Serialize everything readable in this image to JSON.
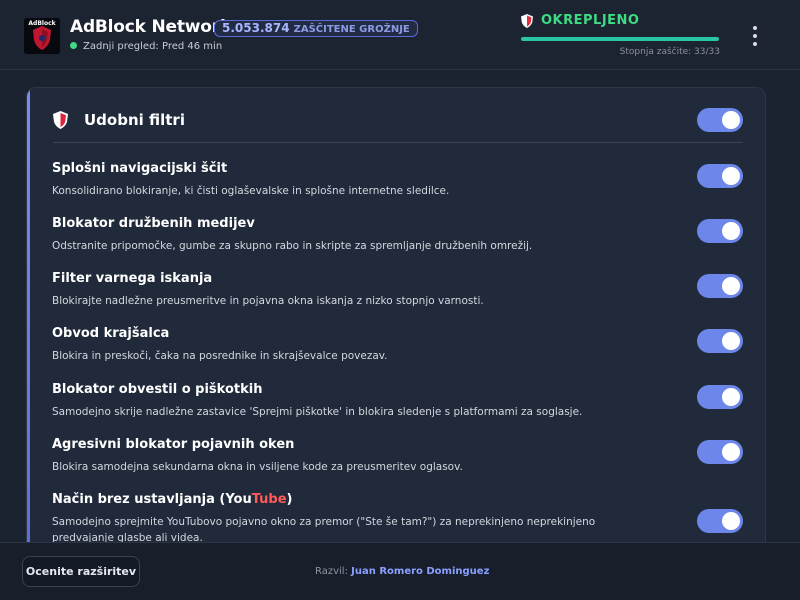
{
  "header": {
    "logo_text": "AdBlock",
    "app_title": "AdBlock Network",
    "threat_count": "5.053.874",
    "threat_label": "ZAŠČITENE GROŽNJE",
    "last_review": "Zadnji pregled: Pred 46 min",
    "status": "OKREPLJENO",
    "protection_progress": 1.0,
    "protection_level": "Stopnja zaščite: 33/33",
    "status_color": "#3ddc84",
    "accent_color": "#6d86ea"
  },
  "card": {
    "title": "Udobni filtri",
    "master_toggle_on": true,
    "filters": [
      {
        "title": "Splošni navigacijski ščit",
        "description": "Konsolidirano blokiranje, ki čisti oglaševalske in splošne internetne sledilce.",
        "enabled": true
      },
      {
        "title": "Blokator družbenih medijev",
        "description": "Odstranite pripomočke, gumbe za skupno rabo in skripte za spremljanje družbenih omrežij.",
        "enabled": true
      },
      {
        "title": "Filter varnega iskanja",
        "description": "Blokirajte nadležne preusmeritve in pojavna okna iskanja z nizko stopnjo varnosti.",
        "enabled": true
      },
      {
        "title": "Obvod krajšalca",
        "description": "Blokira in preskoči, čaka na posrednike in skrajševalce povezav.",
        "enabled": true
      },
      {
        "title": "Blokator obvestil o piškotkih",
        "description": "Samodejno skrije nadležne zastavice 'Sprejmi piškotke' in blokira sledenje s platformami za soglasje.",
        "enabled": true
      },
      {
        "title": "Agresivni blokator pojavnih oken",
        "description": "Blokira samodejna sekundarna okna in vsiljene kode za preusmeritev oglasov.",
        "enabled": true
      },
      {
        "title_prefix": "Način brez ustavljanja (",
        "title_you": "You",
        "title_tube": "Tube",
        "title_suffix": ")",
        "description": "Samodejno sprejmite YouTubovo pojavno okno za premor (\"Ste še tam?\") za neprekinjeno neprekinjeno predvajanje glasbe ali videa.",
        "enabled": true
      }
    ]
  },
  "footer": {
    "rate_button": "Ocenite razširitev",
    "credits_label": "Razvil:",
    "author": "Juan Romero Dominguez"
  }
}
